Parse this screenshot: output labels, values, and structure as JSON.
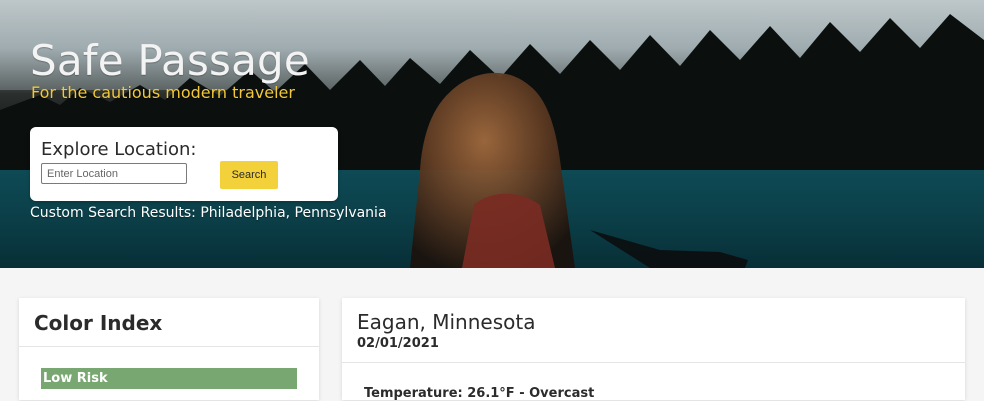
{
  "hero": {
    "title": "Safe Passage",
    "subtitle": "For the cautious modern traveler"
  },
  "search": {
    "heading": "Explore Location:",
    "input_placeholder": "Enter Location",
    "button_label": "Search"
  },
  "custom_results": {
    "text": "Custom Search Results: Philadelphia, Pennsylvania"
  },
  "color_index": {
    "title": "Color Index",
    "items": [
      {
        "label": "Low Risk",
        "color": "#79a771"
      }
    ]
  },
  "location": {
    "name": "Eagan, Minnesota",
    "date": "02/01/2021",
    "temperature_line": "Temperature: 26.1°F - Overcast"
  },
  "colors": {
    "accent_yellow": "#f3d13a",
    "subtitle_yellow": "#f2c83a",
    "low_risk_green": "#79a771"
  }
}
